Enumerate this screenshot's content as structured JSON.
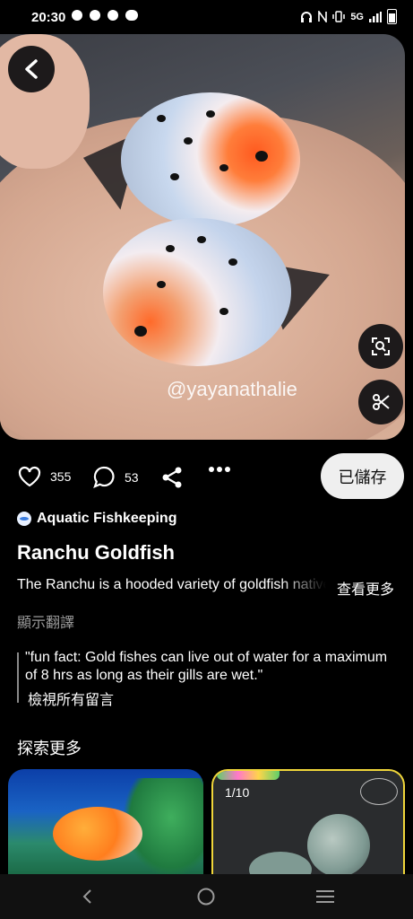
{
  "status_bar": {
    "time": "20:30",
    "network": "5G"
  },
  "pin": {
    "watermark": "@yayanathalie",
    "likes": "355",
    "comments": "53",
    "saved_label": "已儲存",
    "board_name": "Aquatic Fishkeeping",
    "title": "Ranchu Goldfish",
    "description": "The Ranchu is a hooded variety of goldfish native to Japan",
    "see_more": "查看更多",
    "translate": "顯示翻譯",
    "top_comment": "\"fun fact: Gold fishes can live out of water for a maximum of 8 hrs as long as their gills are wet.\"",
    "view_all_comments": "檢視所有留言"
  },
  "explore": {
    "heading": "探索更多",
    "cards": [
      {
        "counter": ""
      },
      {
        "counter": "1/10"
      }
    ]
  },
  "colors": {
    "saved_button_bg": "#efefef",
    "card2_border": "#f0d63a",
    "background": "#000000"
  }
}
